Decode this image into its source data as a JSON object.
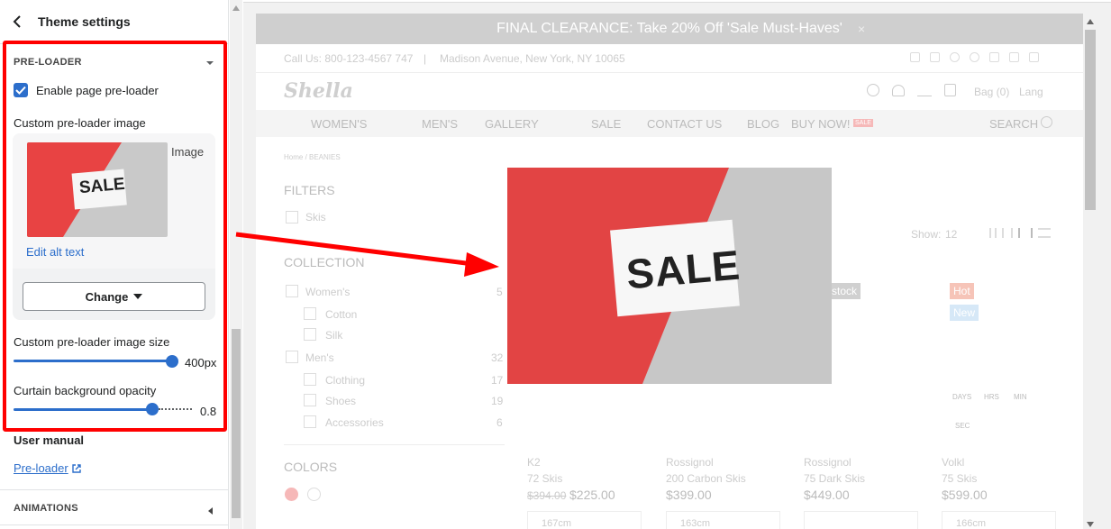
{
  "sidebar": {
    "title": "Theme settings",
    "section_title": "PRE-LOADER",
    "enable_label": "Enable page pre-loader",
    "enable_checked": true,
    "custom_image_label": "Custom pre-loader image",
    "image_label": "Image",
    "sale_text": "SALE",
    "edit_alt_text": "Edit alt text",
    "change_button": "Change",
    "size_label": "Custom pre-loader image size",
    "size_value": "400px",
    "size_fraction": 1.0,
    "opacity_label": "Curtain background opacity",
    "opacity_value": "0.8",
    "opacity_fraction": 0.8,
    "user_manual_label": "User manual",
    "user_manual_link": "Pre-loader",
    "animations_label": "ANIMATIONS"
  },
  "preview": {
    "announcement": "FINAL CLEARANCE: Take 20% Off 'Sale Must-Haves'",
    "close_glyph": "×",
    "phone": "Call Us: 800-123-4567 747",
    "address": "Madison Avenue, New York, NY 10065",
    "logo": "Shella",
    "bag": "Bag (0)",
    "lang": "Lang",
    "nav": [
      "WOMEN'S",
      "MEN'S",
      "GALLERY",
      "SALE",
      "CONTACT US",
      "BLOG",
      "BUY NOW!"
    ],
    "nav_badge": "SALE",
    "search": "SEARCH",
    "breadcrumb": "Home  /  BEANIES",
    "filters": "FILTERS",
    "skis": "Skis",
    "collection": "COLLECTION",
    "collection_items": [
      {
        "label": "Women's",
        "count": "5"
      },
      {
        "label": "Cotton",
        "count": ""
      },
      {
        "label": "Silk",
        "count": ""
      },
      {
        "label": "Men's",
        "count": "32"
      },
      {
        "label": "Clothing",
        "count": "17"
      },
      {
        "label": "Shoes",
        "count": "19"
      },
      {
        "label": "Accessories",
        "count": "6"
      }
    ],
    "colors": "COLORS",
    "show": "Show:",
    "show_value": "12",
    "stock_badge": "stock",
    "hot_badge": "Hot",
    "new_badge": "New",
    "countdown": [
      "DAYS",
      "HRS",
      "MIN",
      "SEC"
    ],
    "products": [
      {
        "brand": "K2",
        "name": "72 Skis",
        "old_price": "$394.00",
        "price": "$225.00",
        "size": "167cm"
      },
      {
        "brand": "Rossignol",
        "name": "200 Carbon Skis",
        "old_price": "",
        "price": "$399.00",
        "size": "163cm"
      },
      {
        "brand": "Rossignol",
        "name": "75 Dark Skis",
        "old_price": "",
        "price": "$449.00",
        "size": ""
      },
      {
        "brand": "Volkl",
        "name": "75 Skis",
        "old_price": "",
        "price": "$599.00",
        "size": "166cm"
      }
    ]
  },
  "colors": {
    "accent": "#2c6ecb",
    "highlight": "#ff0000",
    "sale_red": "#e84343"
  }
}
